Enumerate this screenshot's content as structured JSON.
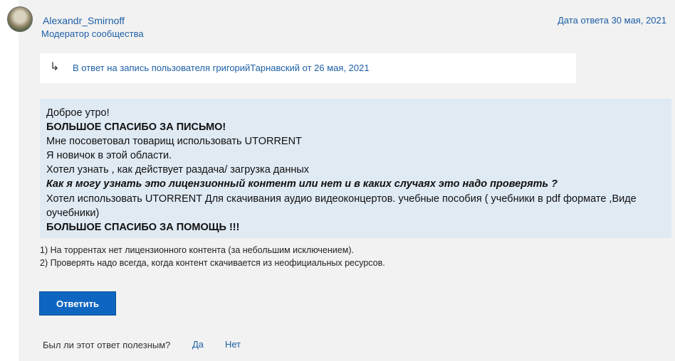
{
  "post": {
    "author": "Alexandr_Smirnoff",
    "role": "Модератор сообщества",
    "date": "Дата ответа 30 мая, 2021",
    "reply_to": {
      "icon": "reply-arrow-icon",
      "text": "В ответ на запись пользователя григорийТарнавский от 26 мая, 2021"
    },
    "quote": {
      "lines": [
        "Доброе утро!",
        "БОЛЬШОЕ СПАСИБО ЗА ПИСЬМО!",
        "Мне посоветовал товарищ использовать UTORRENT",
        "Я новичок в этой области.",
        "Хотел узнать , как действует раздача/ загрузка данных",
        "Как я могу узнать это лицензионный контент или нет  и в каких случаях это надо проверять ?",
        "Хотел использовать UTORRENT  Для скачивания аудио видеоконцертов. учебные пособия ( учебники в pdf формате ,Виде",
        "оучебники)",
        "БОЛЬШОЕ СПАСИБО ЗА ПОМОЩЬ !!!"
      ]
    },
    "answer": [
      "1) На торрентах нет лицензионного контента (за небольшим исключением).",
      "2) Проверять надо всегда, когда контент скачивается из неофициальных ресурсов."
    ]
  },
  "actions": {
    "reply_label": "Ответить",
    "helpful_question": "Был ли этот ответ полезным?",
    "yes_label": "Да",
    "no_label": "Нет"
  },
  "colors": {
    "link": "#1d5fa5",
    "button": "#0f66c0",
    "quote_bg": "#dfeaf3"
  }
}
